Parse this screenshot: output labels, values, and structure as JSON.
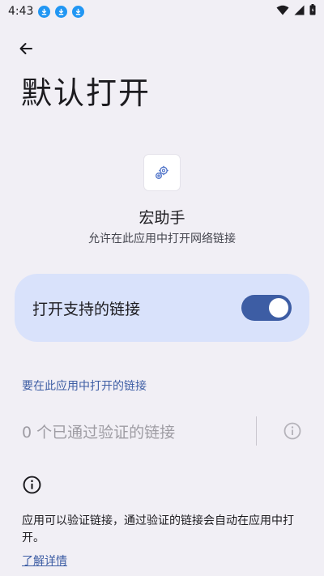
{
  "status_bar": {
    "time": "4:43",
    "notification_icons": [
      "download-icon",
      "download-icon",
      "download-icon"
    ],
    "right_icons": [
      "wifi-icon",
      "signal-icon",
      "battery-icon"
    ]
  },
  "header": {
    "back_icon": "arrow-back-icon",
    "title": "默认打开"
  },
  "app": {
    "icon": "gears-icon",
    "name": "宏助手",
    "subtitle": "允许在此应用中打开网络链接"
  },
  "toggle": {
    "label": "打开支持的链接",
    "enabled": true
  },
  "links_section": {
    "header": "要在此应用中打开的链接",
    "verified_text": "0 个已通过验证的链接",
    "info_icon": "info-icon"
  },
  "info": {
    "icon": "info-icon",
    "text": "应用可以验证链接，通过验证的链接会自动在应用中打开。",
    "learn_more": "了解详情"
  },
  "colors": {
    "background": "#f1eff5",
    "accent": "#3d5da4",
    "card": "#d9e2fb",
    "download_badge": "#2196f3"
  }
}
